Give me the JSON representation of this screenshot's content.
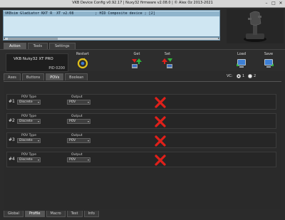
{
  "window": {
    "title": "VKB Device Config v0.92.17 | Nuxy32 firmware v2.08.0 | © Alex Oz 2013-2021",
    "minimize": "–",
    "maximize": "□",
    "close": "✕"
  },
  "devices": {
    "row": "VKBsim Gladiator NXT R  XT v2.08          ; HID Composite device ; [2]",
    "scroll_left": "◂",
    "scroll_right": "▸"
  },
  "main_tabs": [
    {
      "label": "Action",
      "active": true
    },
    {
      "label": "Tools",
      "active": false
    },
    {
      "label": "Settings",
      "active": false
    }
  ],
  "device_card": {
    "name": "VKB Nuky32 XT PRO",
    "pid": "PID 0200"
  },
  "toolbar": {
    "restart": "Restart",
    "get": "Get",
    "set": "Set",
    "load": "Load",
    "save": "Save"
  },
  "sub_tabs": [
    {
      "label": "Axes",
      "active": false
    },
    {
      "label": "Buttons",
      "active": false
    },
    {
      "label": "POVs",
      "active": true
    },
    {
      "label": "Boolean",
      "active": false
    }
  ],
  "vc": {
    "label": "VC:",
    "opt1": "1",
    "opt2": "2",
    "selected": 1
  },
  "pov_rows": [
    {
      "num": "#1",
      "type_label": "POV Type",
      "type_value": "Discrete",
      "output_label": "Output",
      "output_value": "POV"
    },
    {
      "num": "#2",
      "type_label": "POV Type",
      "type_value": "Discrete",
      "output_label": "Output",
      "output_value": "POV"
    },
    {
      "num": "#3",
      "type_label": "POV Type",
      "type_value": "Discrete",
      "output_label": "Output",
      "output_value": "POV"
    },
    {
      "num": "#4",
      "type_label": "POV Type",
      "type_value": "Discrete",
      "output_label": "Output",
      "output_value": "POV"
    }
  ],
  "bottom_tabs": [
    {
      "label": "Global",
      "active": false
    },
    {
      "label": "Profile",
      "active": true
    },
    {
      "label": "Macro",
      "active": false
    },
    {
      "label": "Test",
      "active": false
    },
    {
      "label": "Info",
      "active": false
    }
  ],
  "colors": {
    "accent_red": "#e0201a",
    "device_list_bg": "#cfe6f2",
    "selected_row": "#8fb4cc"
  },
  "icons": {
    "restart": "restart-cycle-icon",
    "get": "get-download-arrows-icon",
    "set": "set-upload-arrows-icon",
    "load": "load-computer-icon",
    "save": "save-computer-icon",
    "pov_status": "red-x-icon",
    "joystick": "joystick-image"
  }
}
